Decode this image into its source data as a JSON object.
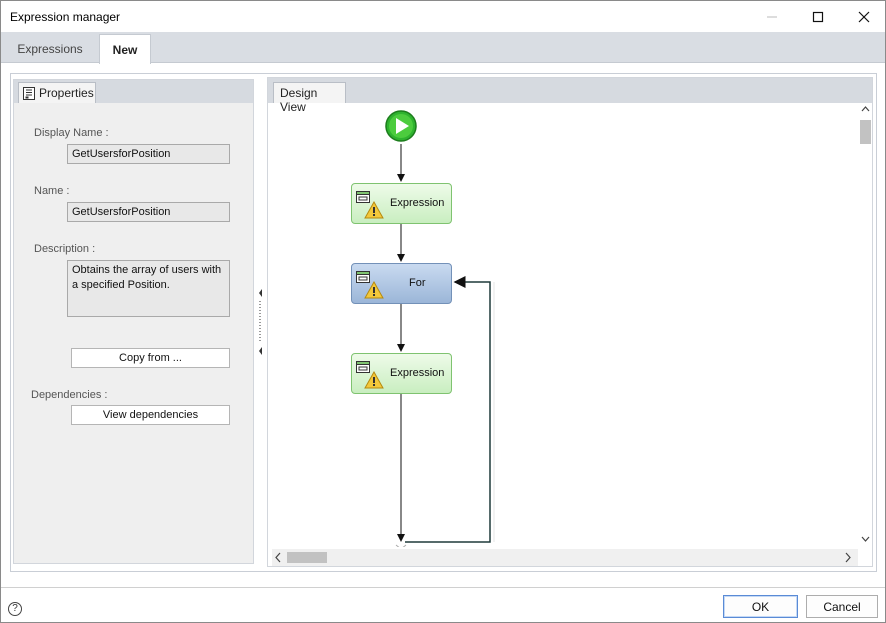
{
  "window": {
    "title": "Expression manager"
  },
  "tabs": [
    {
      "label": "Expressions"
    },
    {
      "label": "New"
    }
  ],
  "properties": {
    "tab_label": "Properties",
    "display_name_label": "Display Name :",
    "display_name_value": "GetUsersforPosition",
    "name_label": "Name :",
    "name_value": "GetUsersforPosition",
    "description_label": "Description :",
    "description_line1": "Obtains the array of users with",
    "description_line2": "a specified Position.",
    "copy_from_label": "Copy from ...",
    "dependencies_label": "Dependencies :",
    "view_dependencies_label": "View dependencies"
  },
  "design_view": {
    "tab_label": "Design View",
    "nodes": [
      {
        "label": "Expression",
        "kind": "expression"
      },
      {
        "label": "For",
        "kind": "loop"
      },
      {
        "label": "Expression",
        "kind": "expression"
      }
    ]
  },
  "footer": {
    "help_symbol": "?",
    "ok_label": "OK",
    "cancel_label": "Cancel"
  },
  "colors": {
    "tab_strip": "#d9dde3",
    "expression_node": "#c9eec0",
    "for_node": "#9bb6d8",
    "start_green": "#2fb32f",
    "ok_border": "#5a8bd6"
  }
}
